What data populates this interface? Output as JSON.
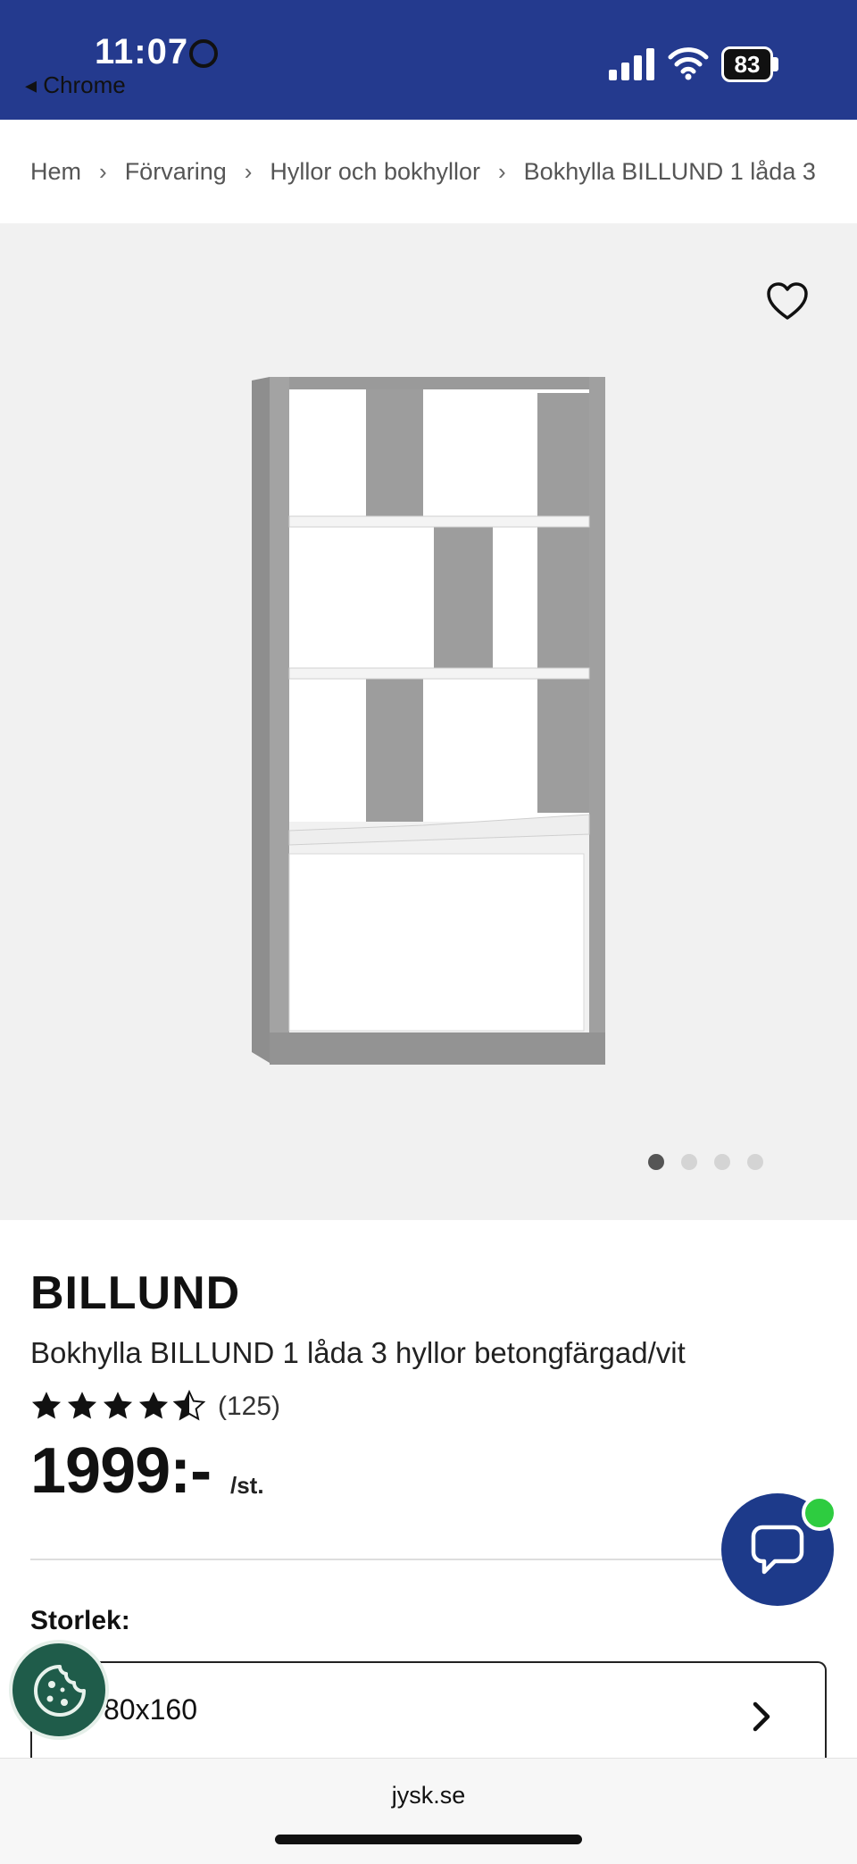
{
  "status_bar": {
    "time": "11:07",
    "back_label": "◂ Chrome",
    "battery": "83"
  },
  "breadcrumb": {
    "items": [
      "Hem",
      "Förvaring",
      "Hyllor och bokhyllor",
      "Bokhylla BILLUND 1 låda 3"
    ]
  },
  "gallery": {
    "image_count": 4,
    "active_index": 0
  },
  "product": {
    "brand": "BILLUND",
    "name": "Bokhylla BILLUND 1 låda 3 hyllor betongfärgad/vit",
    "rating": 4.5,
    "review_count": "(125)",
    "price": "1999:-",
    "price_unit": "/st."
  },
  "size": {
    "label": "Storlek:",
    "value": "80x160"
  },
  "browser": {
    "url": "jysk.se"
  },
  "colors": {
    "header_blue": "#243a8e",
    "chat_blue": "#1d3a8a",
    "cookie_green": "#1f5c4a",
    "badge_green": "#2ecc40"
  }
}
